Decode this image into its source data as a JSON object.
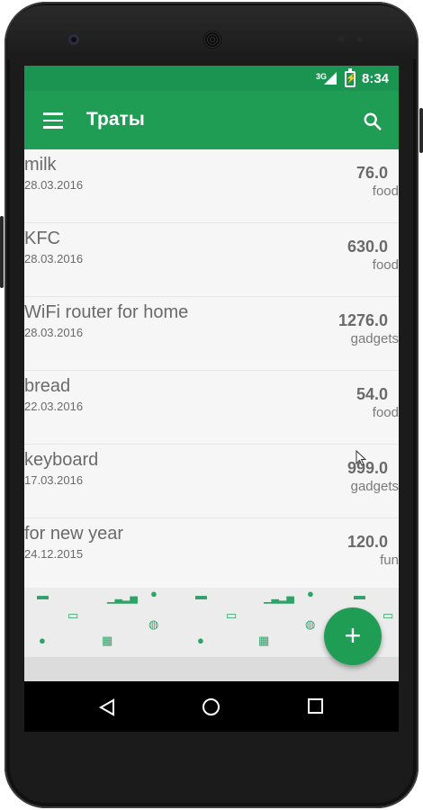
{
  "status_bar": {
    "network": "3G",
    "time": "8:34"
  },
  "app_bar": {
    "title": "Траты",
    "menu_icon": "hamburger-menu-icon",
    "search_icon": "search-icon"
  },
  "expenses": [
    {
      "name": "milk",
      "date": "28.03.2016",
      "amount": "76.0",
      "category": "food"
    },
    {
      "name": "KFC",
      "date": "28.03.2016",
      "amount": "630.0",
      "category": "food"
    },
    {
      "name": "WiFi router for home",
      "date": "28.03.2016",
      "amount": "1276.0",
      "category": "gadgets"
    },
    {
      "name": "bread",
      "date": "22.03.2016",
      "amount": "54.0",
      "category": "food"
    },
    {
      "name": "keyboard",
      "date": "17.03.2016",
      "amount": "999.0",
      "category": "gadgets"
    },
    {
      "name": "for new year",
      "date": "24.12.2015",
      "amount": "120.0",
      "category": "fun"
    }
  ],
  "fab": {
    "label": "+"
  },
  "colors": {
    "primary": "#1f9d55",
    "status_bar": "#1a9450",
    "text": "#6a6a6a"
  }
}
